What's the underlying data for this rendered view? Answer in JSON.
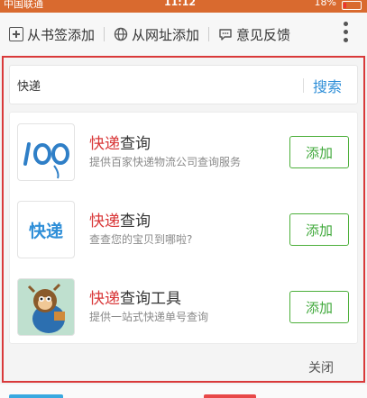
{
  "statusbar": {
    "carrier": "中国联通",
    "time": "11:12",
    "battery": "18%",
    "battery_level": 0.18
  },
  "toolbar": {
    "items": [
      {
        "label": "从书签添加",
        "icon": "bookmark-add-icon"
      },
      {
        "label": "从网址添加",
        "icon": "globe-icon"
      },
      {
        "label": "意见反馈",
        "icon": "chat-bubble-icon"
      }
    ],
    "more_icon": "more-vertical-icon"
  },
  "search": {
    "value": "快递",
    "placeholder": "快递",
    "button_label": "搜索"
  },
  "results": [
    {
      "title_highlight": "快递",
      "title_rest": "查询",
      "desc": "提供百家快递物流公司查询服务",
      "add_label": "添加",
      "logo": "kuaidi100-logo",
      "logo_text": "100"
    },
    {
      "title_highlight": "快递",
      "title_rest": "查询",
      "desc": "查查您的宝贝到哪啦?",
      "add_label": "添加",
      "logo": "kuaidi-text-logo",
      "logo_text": "快递"
    },
    {
      "title_highlight": "快递",
      "title_rest": "查询工具",
      "desc": "提供一站式快递单号查询",
      "add_label": "添加",
      "logo": "cartoon-mascot-logo"
    }
  ],
  "close_label": "关闭",
  "colors": {
    "highlight": "#d9393a",
    "add_button": "#3fa83a",
    "search_button": "#2f8fd8",
    "status_bar": "#d96a2f"
  }
}
